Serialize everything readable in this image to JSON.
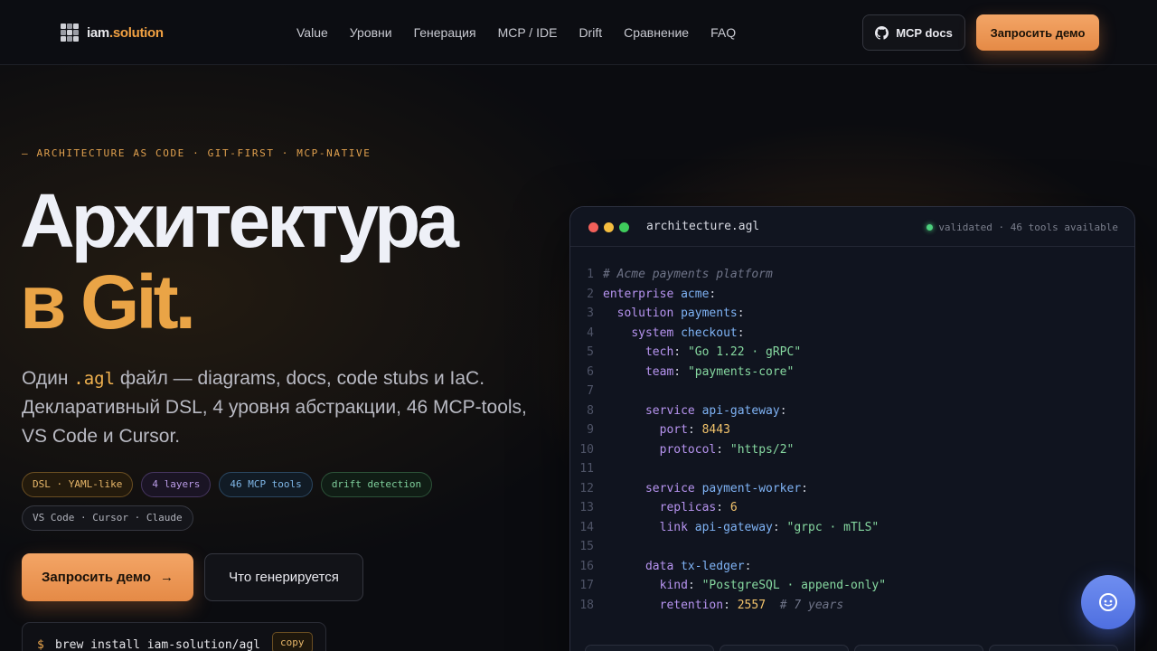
{
  "nav": {
    "logo": {
      "name": "iam",
      "dot": ".",
      "accent": "solution"
    },
    "links": [
      "Value",
      "Уровни",
      "Генерация",
      "MCP / IDE",
      "Drift",
      "Сравнение",
      "FAQ"
    ],
    "mcp_docs": "MCP docs",
    "demo": "Запросить демо"
  },
  "hero": {
    "eyebrow": "— ARCHITECTURE AS CODE · GIT-FIRST · MCP-NATIVE",
    "title_line1": "Архитектура",
    "title_line2": "в Git.",
    "sub_pre": "Один ",
    "sub_code": ".agl",
    "sub_post": " файл — diagrams, docs, code stubs и IaC. Декларативный DSL, 4 уровня абстракции, 46 MCP-tools, VS Code и Cursor.",
    "tags": [
      "DSL · YAML-like",
      "4 layers",
      "46 MCP tools",
      "drift detection",
      "VS Code · Cursor · Claude"
    ],
    "cta_primary": "Запросить демо",
    "cta_arrow": "→",
    "cta_secondary": "Что генерируется",
    "install": {
      "prompt": "$",
      "command": "brew install iam-solution/agl",
      "copy": "copy"
    }
  },
  "editor": {
    "filename": "architecture.agl",
    "status": "validated · 46 tools available",
    "colors": {
      "red": "#f2605a",
      "yellow": "#f5bd3f",
      "green": "#3fcc5c"
    },
    "lines": [
      "# Acme payments platform",
      "enterprise acme:",
      "  solution payments:",
      "    system checkout:",
      "      tech: \"Go 1.22 · gRPC\"",
      "      team: \"payments-core\"",
      "",
      "      service api-gateway:",
      "        port: 8443",
      "        protocol: \"https/2\"",
      "",
      "      service payment-worker:",
      "        replicas: 6",
      "        link api-gateway: \"grpc · mTLS\"",
      "",
      "      data tx-ledger:",
      "        kind: \"PostgreSQL · append-only\"",
      "        retention: 2557  # 7 years"
    ]
  },
  "chat": {
    "icon": "chat-bot-icon"
  }
}
